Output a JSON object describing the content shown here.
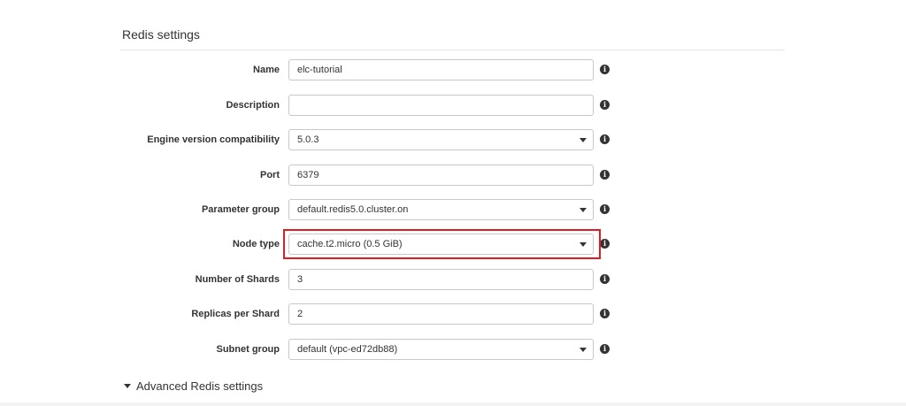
{
  "section": {
    "title": "Redis settings",
    "advanced_label": "Advanced Redis settings"
  },
  "fields": {
    "name": {
      "label": "Name",
      "value": "elc-tutorial"
    },
    "description": {
      "label": "Description",
      "value": ""
    },
    "engine": {
      "label": "Engine version compatibility",
      "value": "5.0.3"
    },
    "port": {
      "label": "Port",
      "value": "6379"
    },
    "parameter_group": {
      "label": "Parameter group",
      "value": "default.redis5.0.cluster.on"
    },
    "node_type": {
      "label": "Node type",
      "value": "cache.t2.micro (0.5 GiB)"
    },
    "shards": {
      "label": "Number of Shards",
      "value": "3"
    },
    "replicas": {
      "label": "Replicas per Shard",
      "value": "2"
    },
    "subnet_group": {
      "label": "Subnet group",
      "value": "default (vpc-ed72db88)"
    }
  },
  "icons": {
    "info": "info-icon",
    "caret": "chevron-down-icon",
    "expand": "triangle-down-icon"
  },
  "colors": {
    "highlight": "#e31b23",
    "border": "#c5c9cc",
    "text": "#333333"
  }
}
